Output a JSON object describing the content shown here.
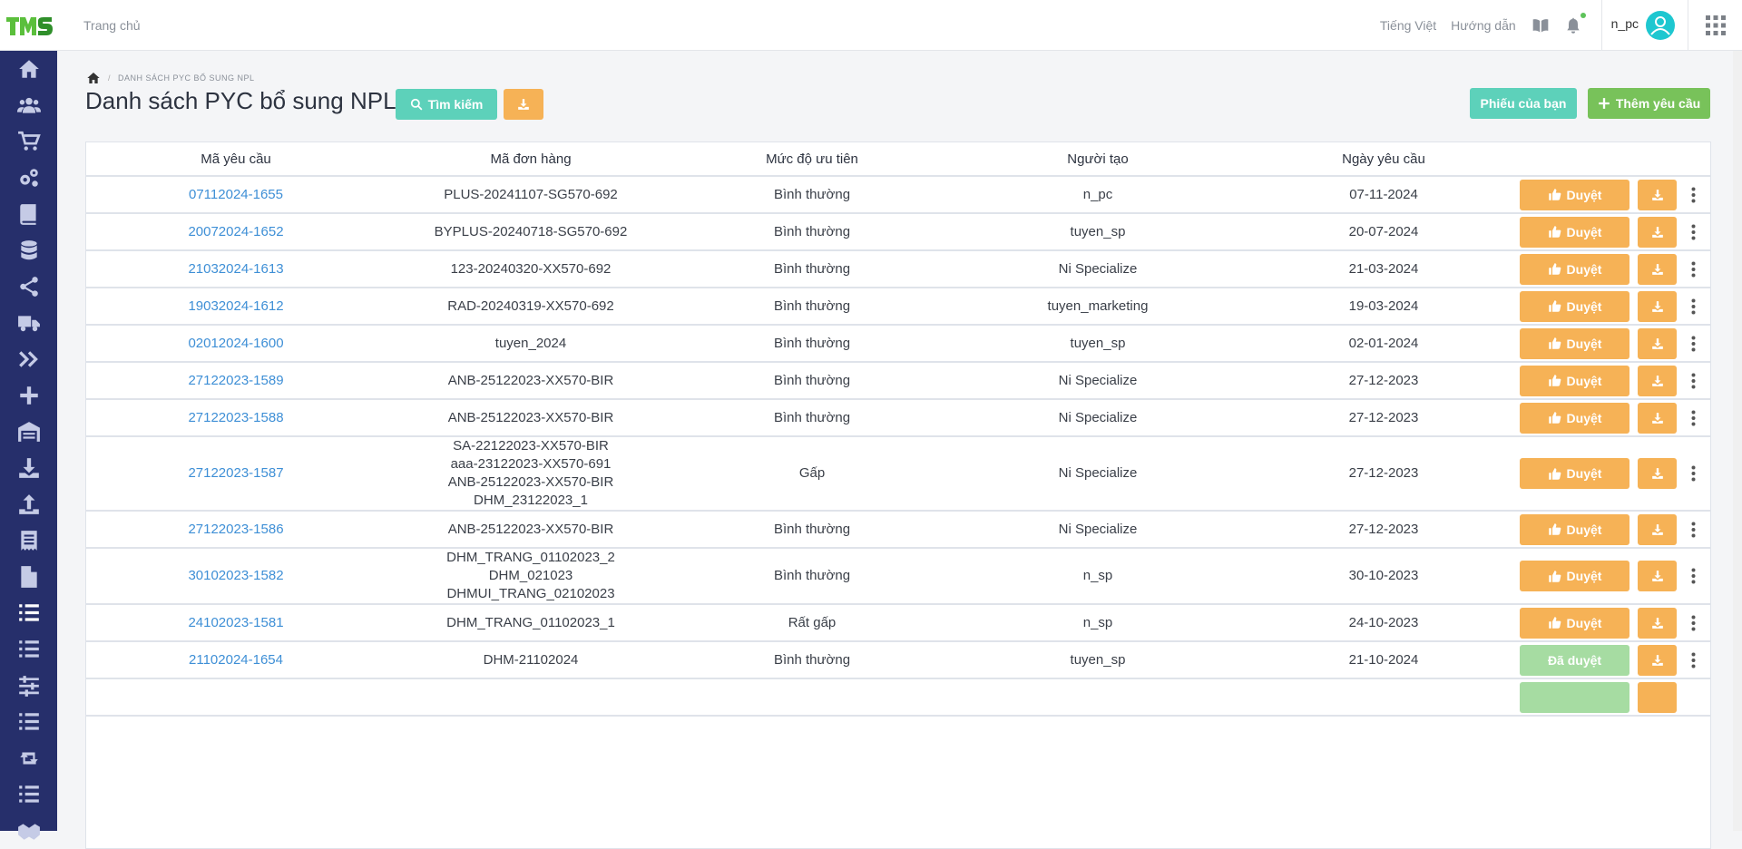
{
  "header": {
    "home_label": "Trang chủ",
    "language_label": "Tiếng Việt",
    "guide_label": "Hướng dẫn",
    "user_name": "n_pc"
  },
  "breadcrumb": {
    "current": "DANH SÁCH PYC BỔ SUNG NPL"
  },
  "page": {
    "title": "Danh sách PYC bổ sung NPL",
    "search_label": "Tìm kiếm",
    "mine_label": "Phiếu của bạn",
    "add_label": "Thêm yêu cầu"
  },
  "table": {
    "columns": [
      "Mã yêu cầu",
      "Mã đơn hàng",
      "Mức độ ưu tiên",
      "Người tạo",
      "Ngày yêu cầu"
    ],
    "rows": [
      {
        "code": "07112024-1655",
        "order": [
          "PLUS-20241107-SG570-692"
        ],
        "priority": "Bình thường",
        "creator": "n_pc",
        "date": "07-11-2024",
        "status": "Duyệt",
        "approved": false
      },
      {
        "code": "20072024-1652",
        "order": [
          "BYPLUS-20240718-SG570-692"
        ],
        "priority": "Bình thường",
        "creator": "tuyen_sp",
        "date": "20-07-2024",
        "status": "Duyệt",
        "approved": false
      },
      {
        "code": "21032024-1613",
        "order": [
          "123-20240320-XX570-692"
        ],
        "priority": "Bình thường",
        "creator": "Ni Specialize",
        "date": "21-03-2024",
        "status": "Duyệt",
        "approved": false
      },
      {
        "code": "19032024-1612",
        "order": [
          "RAD-20240319-XX570-692"
        ],
        "priority": "Bình thường",
        "creator": "tuyen_marketing",
        "date": "19-03-2024",
        "status": "Duyệt",
        "approved": false
      },
      {
        "code": "02012024-1600",
        "order": [
          "tuyen_2024"
        ],
        "priority": "Bình thường",
        "creator": "tuyen_sp",
        "date": "02-01-2024",
        "status": "Duyệt",
        "approved": false
      },
      {
        "code": "27122023-1589",
        "order": [
          "ANB-25122023-XX570-BIR"
        ],
        "priority": "Bình thường",
        "creator": "Ni Specialize",
        "date": "27-12-2023",
        "status": "Duyệt",
        "approved": false
      },
      {
        "code": "27122023-1588",
        "order": [
          "ANB-25122023-XX570-BIR"
        ],
        "priority": "Bình thường",
        "creator": "Ni Specialize",
        "date": "27-12-2023",
        "status": "Duyệt",
        "approved": false
      },
      {
        "code": "27122023-1587",
        "order": [
          "SA-22122023-XX570-BIR",
          "aaa-23122023-XX570-691",
          "ANB-25122023-XX570-BIR",
          "DHM_23122023_1"
        ],
        "priority": "Gấp",
        "creator": "Ni Specialize",
        "date": "27-12-2023",
        "status": "Duyệt",
        "approved": false
      },
      {
        "code": "27122023-1586",
        "order": [
          "ANB-25122023-XX570-BIR"
        ],
        "priority": "Bình thường",
        "creator": "Ni Specialize",
        "date": "27-12-2023",
        "status": "Duyệt",
        "approved": false
      },
      {
        "code": "30102023-1582",
        "order": [
          "DHM_TRANG_01102023_2",
          "DHM_021023",
          "DHMUI_TRANG_02102023"
        ],
        "priority": "Bình thường",
        "creator": "n_sp",
        "date": "30-10-2023",
        "status": "Duyệt",
        "approved": false
      },
      {
        "code": "24102023-1581",
        "order": [
          "DHM_TRANG_01102023_1"
        ],
        "priority": "Rất gấp",
        "creator": "n_sp",
        "date": "24-10-2023",
        "status": "Duyệt",
        "approved": false
      },
      {
        "code": "21102024-1654",
        "order": [
          "DHM-21102024"
        ],
        "priority": "Bình thường",
        "creator": "tuyen_sp",
        "date": "21-10-2024",
        "status": "Đã duyệt",
        "approved": true
      }
    ]
  },
  "colors": {
    "sidebar": "#262f6b",
    "teal": "#5dd1ba",
    "orange": "#f6b256",
    "green": "#78c25a",
    "link": "#3e8fd6"
  }
}
